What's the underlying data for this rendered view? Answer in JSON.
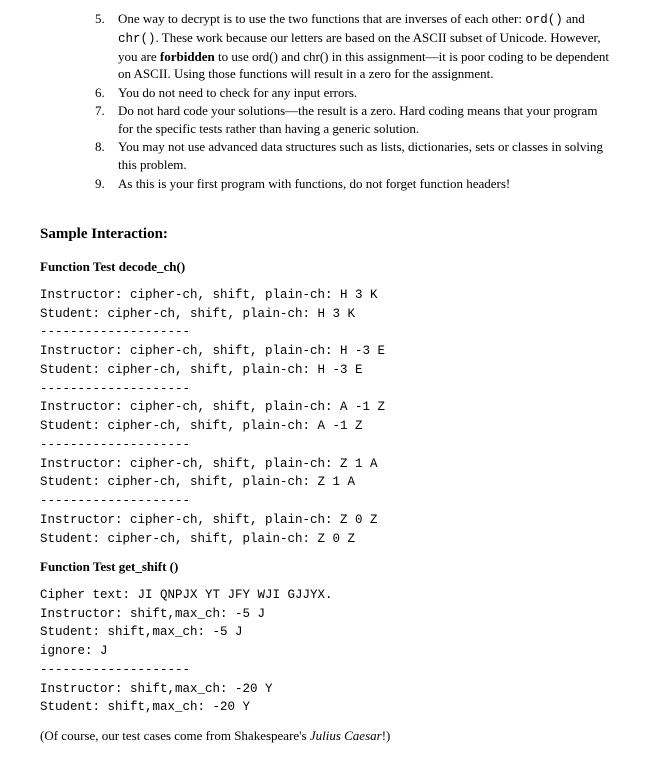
{
  "list": {
    "start": 5,
    "items": [
      {
        "prefix": "One way to decrypt is to use the two functions that are inverses of each other: ",
        "code1": "ord()",
        "mid1": " and ",
        "code2": "chr()",
        "mid2": ". These work because our letters are based on the ASCII subset of Unicode. However, you are ",
        "boldword": "forbidden",
        "suffix": " to use ord() and chr() in this assignment—it is poor coding to be dependent on ASCII. Using those functions will result in a zero for the assignment."
      },
      {
        "text": "You do not need to check for any input errors."
      },
      {
        "text": "Do not hard code your solutions—the result is a zero. Hard coding means that your program for the specific tests rather than having a generic solution."
      },
      {
        "text": "You may not use advanced data structures such as lists, dictionaries, sets or classes in solving this problem."
      },
      {
        "text": " As this is your first program with functions, do not forget function headers!"
      }
    ]
  },
  "section_title": "Sample Interaction:",
  "test1": {
    "title": "Function Test decode_ch()",
    "block": "Instructor: cipher-ch, shift, plain-ch: H 3 K\nStudent: cipher-ch, shift, plain-ch: H 3 K\n--------------------\nInstructor: cipher-ch, shift, plain-ch: H -3 E\nStudent: cipher-ch, shift, plain-ch: H -3 E\n--------------------\nInstructor: cipher-ch, shift, plain-ch: A -1 Z\nStudent: cipher-ch, shift, plain-ch: A -1 Z\n--------------------\nInstructor: cipher-ch, shift, plain-ch: Z 1 A\nStudent: cipher-ch, shift, plain-ch: Z 1 A\n--------------------\nInstructor: cipher-ch, shift, plain-ch: Z 0 Z\nStudent: cipher-ch, shift, plain-ch: Z 0 Z"
  },
  "test2": {
    "title": "Function Test get_shift ()",
    "block": "Cipher text: JI QNPJX YT JFY WJI GJJYX.\nInstructor: shift,max_ch: -5 J\nStudent: shift,max_ch: -5 J\nignore: J\n--------------------\nInstructor: shift,max_ch: -20 Y\nStudent: shift,max_ch: -20 Y"
  },
  "footnote": {
    "prefix": "(Of course, our test cases come from Shakespeare's ",
    "italic": "Julius Caesar",
    "suffix": "!)"
  }
}
